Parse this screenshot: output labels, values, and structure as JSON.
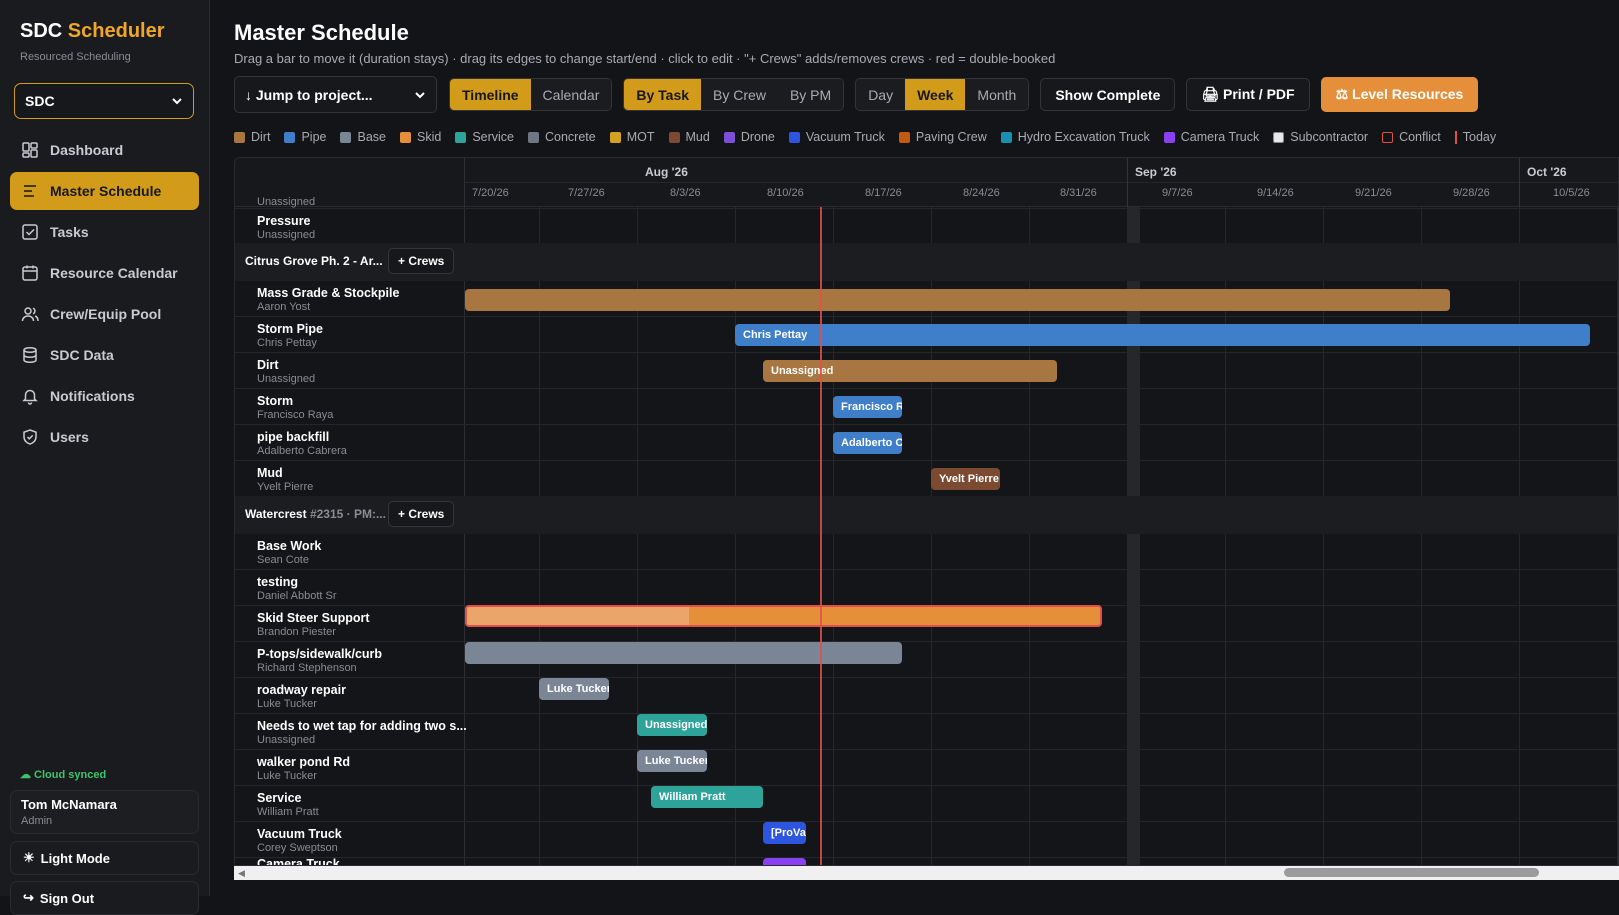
{
  "brand": {
    "name_a": "SDC",
    "name_b": "Scheduler",
    "subtitle": "Resourced Scheduling"
  },
  "org": {
    "selected": "SDC"
  },
  "nav": [
    {
      "label": "Dashboard",
      "icon": "dashboard-icon"
    },
    {
      "label": "Master Schedule",
      "icon": "schedule-icon"
    },
    {
      "label": "Tasks",
      "icon": "tasks-icon"
    },
    {
      "label": "Resource Calendar",
      "icon": "calendar-icon"
    },
    {
      "label": "Crew/Equip Pool",
      "icon": "users-icon"
    },
    {
      "label": "SDC Data",
      "icon": "database-icon"
    },
    {
      "label": "Notifications",
      "icon": "bell-icon"
    },
    {
      "label": "Users",
      "icon": "shield-icon"
    }
  ],
  "sync": "☁ Cloud synced",
  "user": {
    "name": "Tom McNamara",
    "role": "Admin"
  },
  "light_mode": "Light Mode",
  "sign_out": "Sign Out",
  "page": {
    "title": "Master Schedule",
    "subtitle": "Drag a bar to move it (duration stays) · drag its edges to change start/end · click to edit · \"+ Crews\" adds/removes crews · red = double-booked"
  },
  "toolbar": {
    "jump": "↓ Jump to project...",
    "view_tabs": [
      "Timeline",
      "Calendar"
    ],
    "group_tabs": [
      "By Task",
      "By Crew",
      "By PM"
    ],
    "scale_tabs": [
      "Day",
      "Week",
      "Month"
    ],
    "show_complete": "Show Complete",
    "print": "🖨 Print / PDF",
    "level": "⚖ Level Resources"
  },
  "legend": [
    {
      "label": "Dirt",
      "color": "#a87640"
    },
    {
      "label": "Pipe",
      "color": "#3f7fc9"
    },
    {
      "label": "Base",
      "color": "#7a8596"
    },
    {
      "label": "Skid",
      "color": "#e58f3b"
    },
    {
      "label": "Service",
      "color": "#2ea39a"
    },
    {
      "label": "Concrete",
      "color": "#6f7787"
    },
    {
      "label": "MOT",
      "color": "#d4a021"
    },
    {
      "label": "Mud",
      "color": "#7b4a30"
    },
    {
      "label": "Drone",
      "color": "#7c4fd8"
    },
    {
      "label": "Vacuum Truck",
      "color": "#2d55e0"
    },
    {
      "label": "Paving Crew",
      "color": "#c25a12"
    },
    {
      "label": "Hydro Excavation Truck",
      "color": "#1a8fb0"
    },
    {
      "label": "Camera Truck",
      "color": "#8a3ff0"
    },
    {
      "label": "Subcontractor",
      "color": "#e8e8e8"
    },
    {
      "label": "Conflict",
      "color": "#e0504a"
    },
    {
      "label": "Today",
      "color": "#e0504a"
    }
  ],
  "timeline": {
    "months": [
      "Aug '26",
      "Sep '26",
      "Oct '26"
    ],
    "weeks": [
      "7/20/26",
      "7/27/26",
      "8/3/26",
      "8/10/26",
      "8/17/26",
      "8/24/26",
      "8/31/26",
      "9/7/26",
      "9/14/26",
      "9/21/26",
      "9/28/26",
      "10/5/26"
    ],
    "today": "8/14/26"
  },
  "top_partial": {
    "sub": "Unassigned"
  },
  "rows_a": [
    {
      "name": "Pressure",
      "sub": "Unassigned"
    }
  ],
  "group1": {
    "name": "Citrus Grove Ph. 2 - Ar...",
    "crews": "+ Crews"
  },
  "rows_b": [
    {
      "name": "Mass Grade & Stockpile",
      "sub": "Aaron Yost",
      "bar": ""
    },
    {
      "name": "Storm Pipe",
      "sub": "Chris Pettay",
      "bar": "Chris Pettay"
    },
    {
      "name": "Dirt",
      "sub": "Unassigned",
      "bar": "Unassigned"
    },
    {
      "name": "Storm",
      "sub": "Francisco Raya",
      "bar": "Francisco Ra"
    },
    {
      "name": "pipe backfill",
      "sub": "Adalberto Cabrera",
      "bar": "Adalberto C"
    },
    {
      "name": "Mud",
      "sub": "Yvelt Pierre",
      "bar": "Yvelt Pierre"
    }
  ],
  "group2": {
    "name": "Watercrest",
    "tag": "#2315 · PM:...",
    "crews": "+ Crews"
  },
  "rows_c": [
    {
      "name": "Base Work",
      "sub": "Sean Cote",
      "bar": ""
    },
    {
      "name": "testing",
      "sub": "Daniel Abbott Sr",
      "bar": ""
    },
    {
      "name": "Skid Steer Support",
      "sub": "Brandon Piester",
      "bar": ""
    },
    {
      "name": "P-tops/sidewalk/curb",
      "sub": "Richard Stephenson",
      "bar": ""
    },
    {
      "name": "roadway repair",
      "sub": "Luke Tucker",
      "bar": "Luke Tucker"
    },
    {
      "name": "Needs to wet tap for adding two s...",
      "sub": "Unassigned",
      "bar": "Unassigned"
    },
    {
      "name": "walker pond Rd",
      "sub": "Luke Tucker",
      "bar": "Luke Tucker"
    },
    {
      "name": "Service",
      "sub": "William Pratt",
      "bar": "William Pratt"
    },
    {
      "name": "Vacuum Truck",
      "sub": "Corey Sweptson",
      "bar": "[ProVa"
    },
    {
      "name": "Camera Truck",
      "sub": "",
      "bar": ""
    }
  ]
}
